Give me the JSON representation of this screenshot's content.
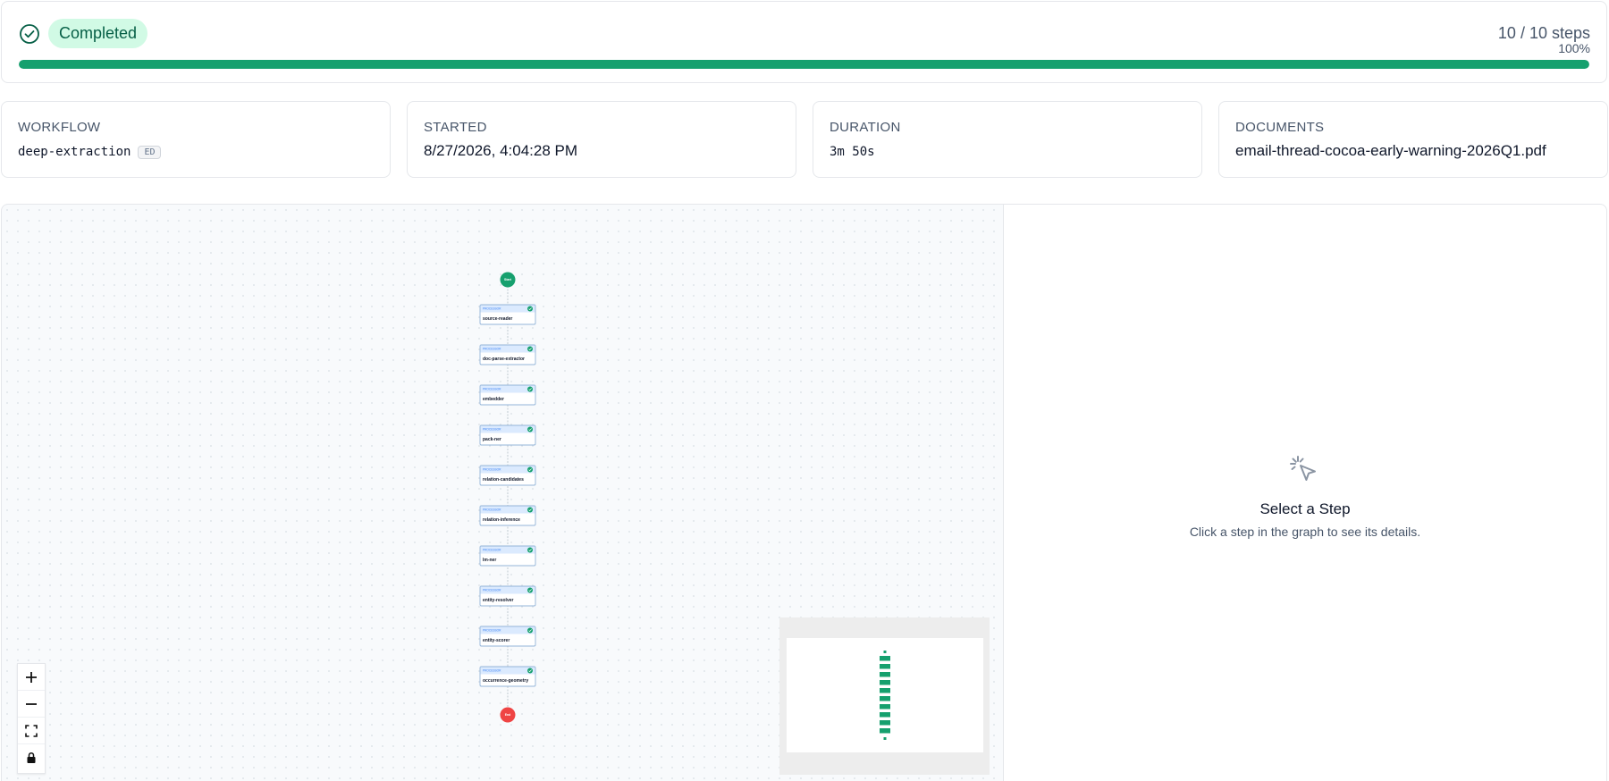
{
  "status": {
    "label": "Completed",
    "steps_text": "10 / 10 steps",
    "percent_text": "100%",
    "progress": 1.0,
    "accent_color": "#16a06e"
  },
  "info": {
    "workflow": {
      "label": "WORKFLOW",
      "value": "deep-extraction",
      "badge": "ED"
    },
    "started": {
      "label": "STARTED",
      "value": "8/27/2026, 4:04:28 PM"
    },
    "duration": {
      "label": "DURATION",
      "value": "3m 50s"
    },
    "documents": {
      "label": "DOCUMENTS",
      "value": "email-thread-cocoa-early-warning-2026Q1.pdf"
    }
  },
  "graph": {
    "start_label": "Start",
    "end_label": "End",
    "node_kind": "PROCESSOR",
    "steps": [
      {
        "name": "source-reader",
        "status": "completed"
      },
      {
        "name": "doc-parse-extractor",
        "status": "completed"
      },
      {
        "name": "embedder",
        "status": "completed"
      },
      {
        "name": "pack-ner",
        "status": "completed"
      },
      {
        "name": "relation-candidates",
        "status": "completed"
      },
      {
        "name": "relation-inference",
        "status": "completed"
      },
      {
        "name": "lm-ner",
        "status": "completed"
      },
      {
        "name": "entity-resolver",
        "status": "completed"
      },
      {
        "name": "entity-scorer",
        "status": "completed"
      },
      {
        "name": "occurrence-geometry",
        "status": "completed"
      }
    ],
    "colors": {
      "start": "#16a06e",
      "end": "#ef4444",
      "node_border": "#93b4d8",
      "node_header": "#dbeafe",
      "check": "#16a06e"
    }
  },
  "controls": {
    "zoom_in_icon": "plus-icon",
    "zoom_out_icon": "minus-icon",
    "fit_icon": "fit-view-icon",
    "lock_icon": "lock-icon"
  },
  "details": {
    "title": "Select a Step",
    "subtitle": "Click a step in the graph to see its details."
  }
}
